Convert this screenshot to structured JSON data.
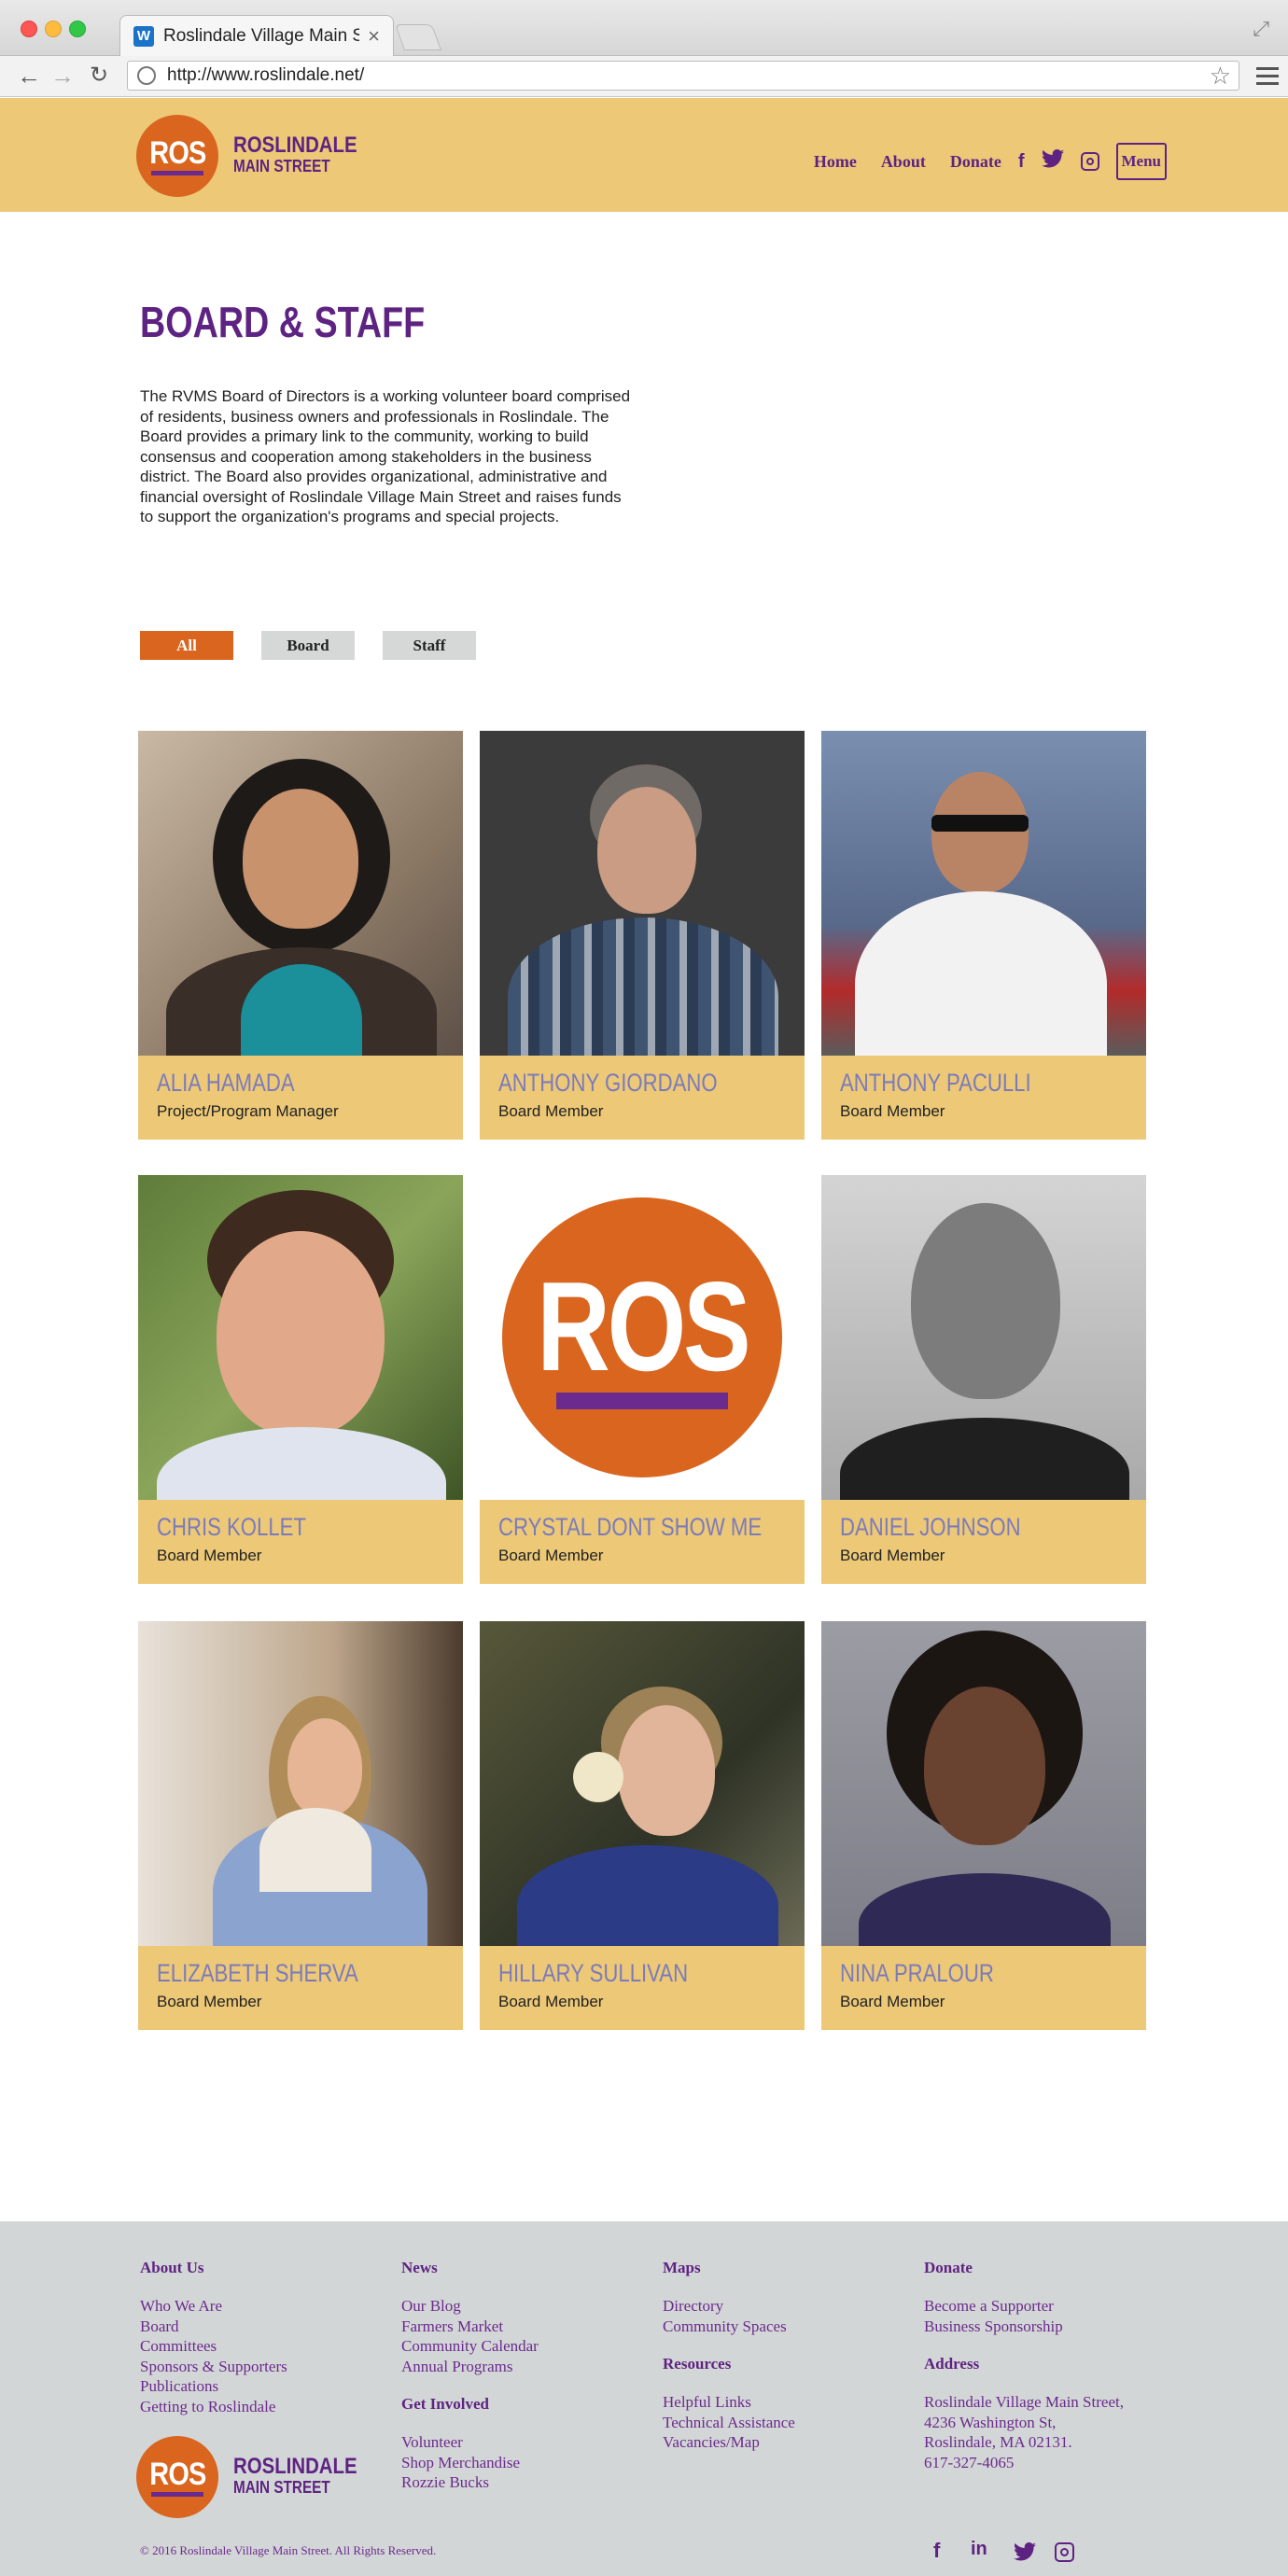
{
  "browser": {
    "tab_title": "Roslindale Village Main St",
    "tab_close": "×",
    "favicon": "W",
    "url": "http://www.roslindale.net/"
  },
  "header": {
    "logo_mark": "ROS",
    "logo_line1": "ROSLINDALE",
    "logo_line2": "MAIN STREET",
    "nav": {
      "home": "Home",
      "about": "About",
      "donate": "Donate",
      "menu": "Menu"
    },
    "social_icons": [
      "facebook-icon",
      "twitter-icon",
      "instagram-icon"
    ]
  },
  "main": {
    "title": "BOARD & STAFF",
    "intro": "The RVMS Board of Directors is a working volunteer board comprised of residents, business owners and professionals in Roslindale. The Board provides a primary link to the community, working to build consensus and cooperation among stakeholders in the business district. The Board also provides organizational, administrative and financial oversight of Roslindale Village Main Street and raises funds to support the organization's programs and special projects.",
    "filters": [
      {
        "label": "All",
        "active": true
      },
      {
        "label": "Board",
        "active": false
      },
      {
        "label": "Staff",
        "active": false
      }
    ],
    "people": [
      {
        "name": "ALIA HAMADA",
        "role": "Project/Program Manager"
      },
      {
        "name": "ANTHONY GIORDANO",
        "role": "Board Member"
      },
      {
        "name": "ANTHONY PACULLI",
        "role": "Board Member"
      },
      {
        "name": "CHRIS KOLLET",
        "role": "Board Member"
      },
      {
        "name": "CRYSTAL DONT SHOW ME",
        "role": "Board Member"
      },
      {
        "name": "DANIEL JOHNSON",
        "role": "Board Member"
      },
      {
        "name": "ELIZABETH SHERVA",
        "role": "Board Member"
      },
      {
        "name": "HILLARY SULLIVAN",
        "role": "Board Member"
      },
      {
        "name": "NINA PRALOUR",
        "role": "Board Member"
      }
    ],
    "placeholder_logo": "ROS"
  },
  "footer": {
    "about": {
      "heading": "About Us",
      "links": [
        "Who We Are",
        "Board",
        "Committees",
        "Sponsors & Supporters",
        "Publications",
        "Getting to Roslindale"
      ]
    },
    "news": {
      "heading": "News",
      "links": [
        "Our Blog",
        "Farmers Market",
        "Community Calendar",
        "Annual Programs"
      ]
    },
    "involved": {
      "heading": "Get Involved",
      "links": [
        "Volunteer",
        "Shop Merchandise",
        "Rozzie Bucks"
      ]
    },
    "maps": {
      "heading": "Maps",
      "links": [
        "Directory",
        "Community Spaces"
      ]
    },
    "resources": {
      "heading": "Resources",
      "links": [
        "Helpful Links",
        "Technical Assistance",
        "Vacancies/Map"
      ]
    },
    "donate": {
      "heading": "Donate",
      "links": [
        "Become a Supporter",
        "Business Sponsorship"
      ]
    },
    "address": {
      "heading": "Address",
      "lines": [
        "Roslindale Village Main Street,",
        "4236 Washington St,",
        "Roslindale, MA 02131.",
        "617-327-4065"
      ]
    },
    "copyright": "© 2016 Roslindale Village Main Street. All Rights Reserved.",
    "social_icons": [
      "facebook-icon",
      "linkedin-icon",
      "twitter-icon",
      "instagram-icon"
    ]
  },
  "colors": {
    "brand_purple": "#5e2382",
    "brand_orange": "#d9651f",
    "header_gold": "#ecc877",
    "name_blue": "#7b7bbb",
    "footer_gray": "#d3d6d6"
  }
}
